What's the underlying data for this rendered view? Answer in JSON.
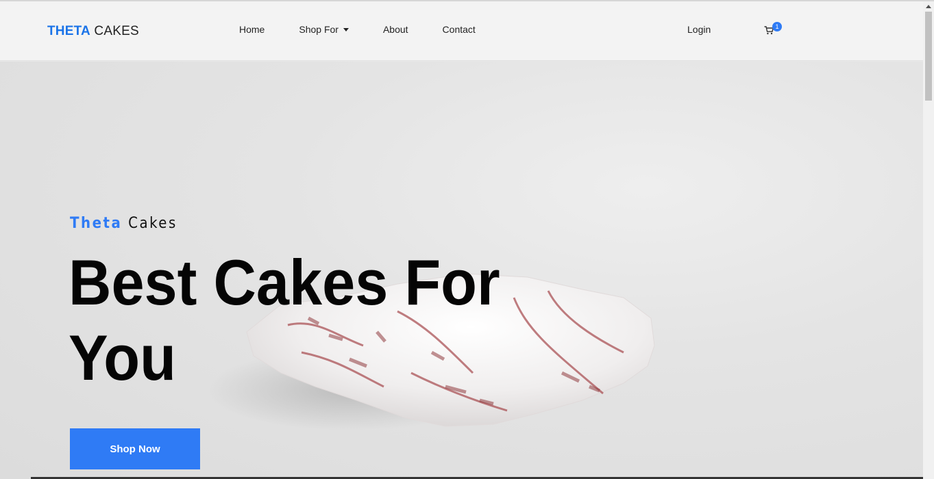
{
  "brand": {
    "accent": "THETA",
    "rest": " CAKES"
  },
  "nav": {
    "home": "Home",
    "shop": "Shop For",
    "about": "About",
    "contact": "Contact",
    "login": "Login"
  },
  "cart": {
    "count": "1",
    "icon": "cart-icon"
  },
  "hero": {
    "eyebrow_accent": "Theta",
    "eyebrow_rest": " Cakes",
    "headline_line1": "Best Cakes For",
    "headline_line2": "You",
    "cta": "Shop Now"
  },
  "colors": {
    "accent": "#2f7bf5",
    "brand": "#1a73e8"
  }
}
